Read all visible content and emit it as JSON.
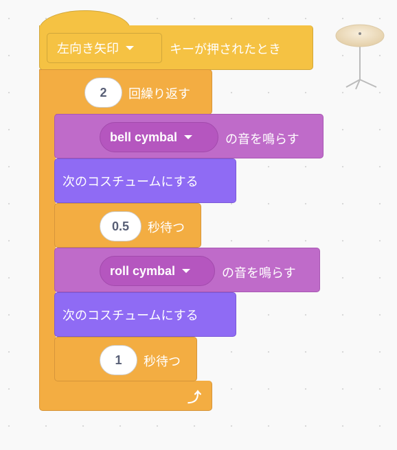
{
  "hat_block": {
    "key_dropdown": "左向き矢印",
    "label": "キーが押されたとき"
  },
  "repeat_block": {
    "count": "2",
    "label": "回繰り返す"
  },
  "blocks": [
    {
      "type": "sound",
      "sound": "bell cymbal",
      "label": "の音を鳴らす"
    },
    {
      "type": "looks",
      "label": "次のコスチュームにする"
    },
    {
      "type": "wait",
      "value": "0.5",
      "label": "秒待つ"
    },
    {
      "type": "sound",
      "sound": "roll cymbal",
      "label": "の音を鳴らす"
    },
    {
      "type": "looks",
      "label": "次のコスチュームにする"
    },
    {
      "type": "wait",
      "value": "1",
      "label": "秒待つ"
    }
  ],
  "colors": {
    "event": "#f5c243",
    "control": "#f3ad42",
    "sound": "#bf6bc9",
    "looks": "#8f6bf4"
  }
}
